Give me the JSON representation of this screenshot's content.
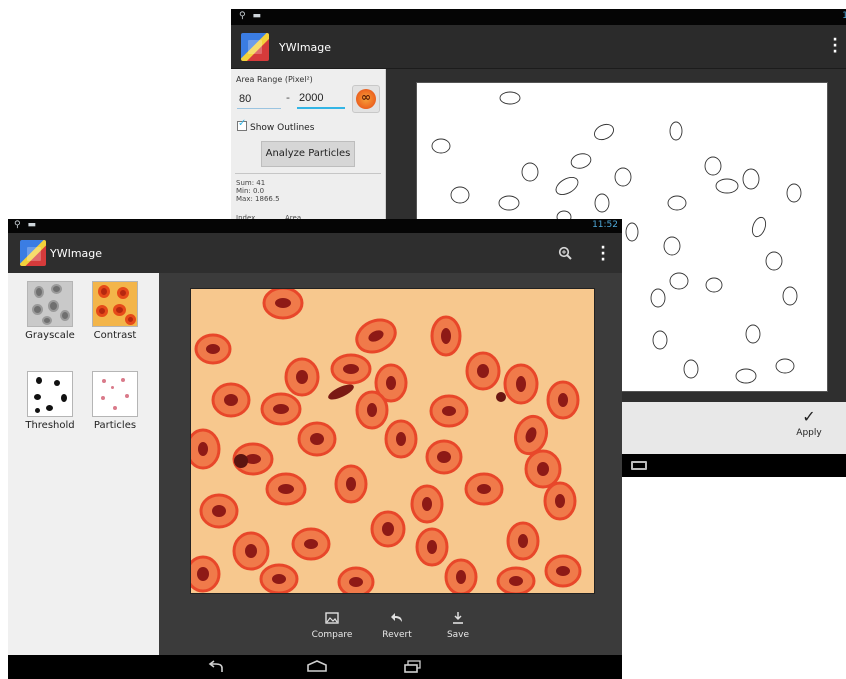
{
  "back_screen": {
    "status_time": "1",
    "app_title": "YWImage",
    "area_range_label": "Area Range (Pixel²)",
    "range_min": "80",
    "range_dash": "-",
    "range_max": "2000",
    "infinity_glyph": "∞",
    "show_outlines_label": "Show Outlines",
    "show_outlines_checked": true,
    "analyze_button": "Analyze Particles",
    "stats": {
      "sum": "Sum: 41",
      "min": "Min: 0.0",
      "max": "Max: 1866.5"
    },
    "table_headers": {
      "index": "Index",
      "area": "Area"
    },
    "apply_label": "Apply",
    "accent_color": "#33b5e5",
    "icons": [
      "app-logo-icon",
      "overflow-menu-icon",
      "infinity-icon",
      "checkbox-icon",
      "apply-check-icon",
      "recents-icon"
    ]
  },
  "front_screen": {
    "status_time": "11:52",
    "app_title": "YWImage",
    "tools": [
      {
        "label": "Grayscale"
      },
      {
        "label": "Contrast"
      },
      {
        "label": "Threshold"
      },
      {
        "label": "Particles"
      }
    ],
    "toolbar": {
      "compare": "Compare",
      "revert": "Revert",
      "save": "Save"
    },
    "image_colors": {
      "background": "#f7c88e",
      "cell": "#e2542d",
      "nucleus": "#8e1a16"
    },
    "icons": [
      "app-logo-icon",
      "zoom-icon",
      "overflow-menu-icon",
      "compare-icon",
      "revert-icon",
      "save-icon",
      "back-nav-icon",
      "home-nav-icon",
      "recents-nav-icon"
    ]
  }
}
